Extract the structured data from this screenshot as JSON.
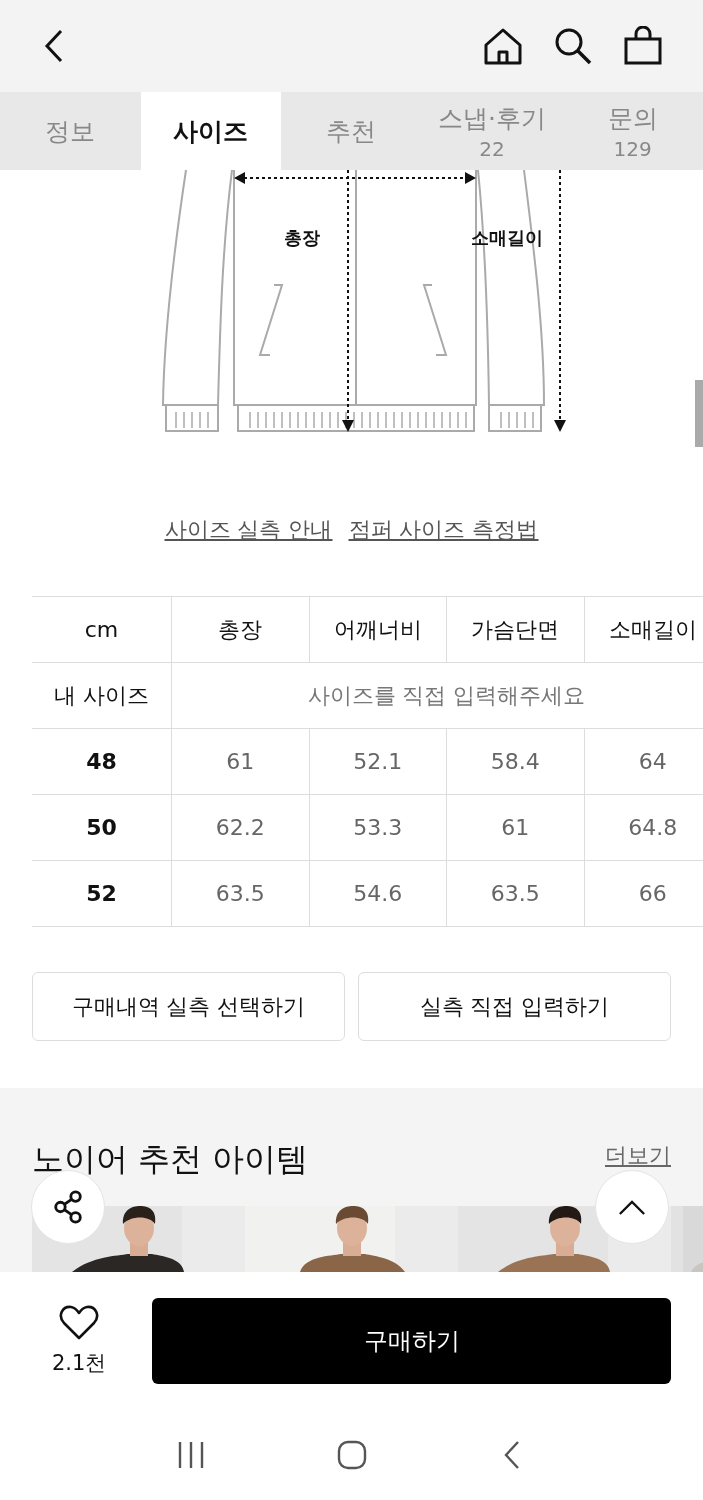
{
  "tabs": [
    {
      "label": "정보",
      "selected": false
    },
    {
      "label": "사이즈",
      "selected": true
    },
    {
      "label": "추천",
      "selected": false
    },
    {
      "label": "스냅·후기",
      "count": "22",
      "selected": false
    },
    {
      "label": "문의",
      "count": "129",
      "selected": false
    }
  ],
  "diagram": {
    "labels": [
      "총장",
      "소매길이"
    ]
  },
  "links": [
    "사이즈 실측 안내",
    "점퍼 사이즈 측정법"
  ],
  "size_table": {
    "columns": [
      "cm",
      "총장",
      "어깨너비",
      "가슴단면",
      "소매길이"
    ],
    "my_size": {
      "label": "내 사이즈",
      "placeholder": "사이즈를 직접 입력해주세요"
    },
    "rows": [
      [
        "48",
        "61",
        "52.1",
        "58.4",
        "64"
      ],
      [
        "50",
        "62.2",
        "53.3",
        "61",
        "64.8"
      ],
      [
        "52",
        "63.5",
        "54.6",
        "63.5",
        "66"
      ]
    ]
  },
  "buttons": [
    "구매내역 실측 선택하기",
    "실측 직접 입력하기"
  ],
  "recommend": {
    "title": "노이어 추천 아이템",
    "more": "더보기"
  },
  "purchase": {
    "likes": "2.1천",
    "button": "구매하기"
  }
}
